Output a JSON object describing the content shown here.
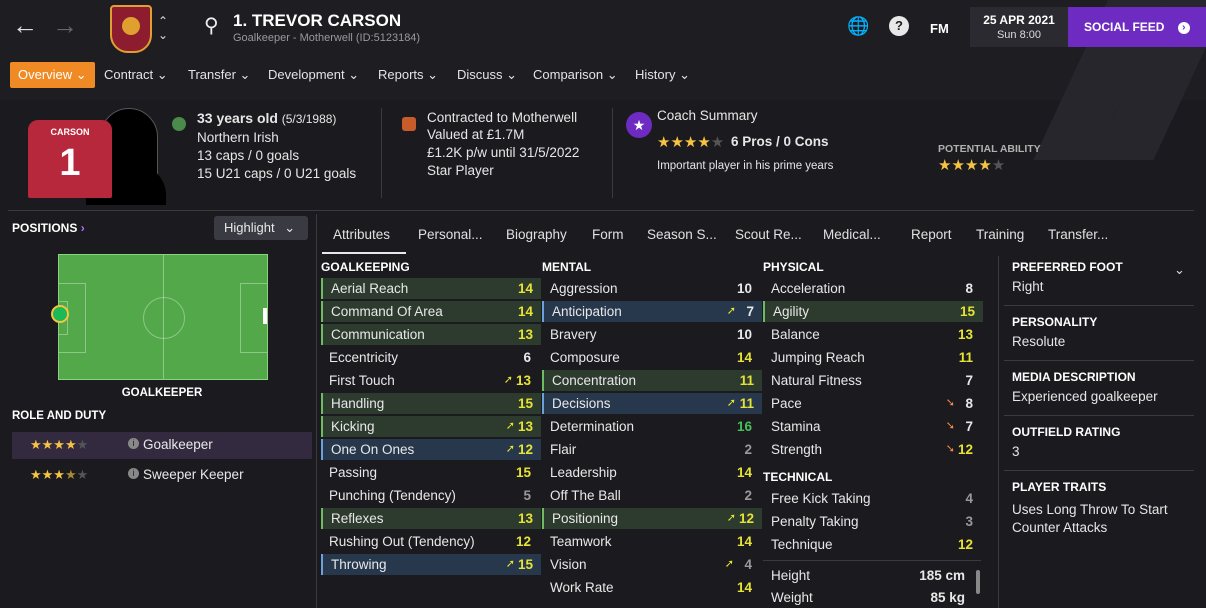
{
  "header": {
    "player_name": "1. TREVOR CARSON",
    "player_sub": "Goalkeeper - Motherwell (ID:5123184)",
    "fm_label": "FM",
    "help_label": "?",
    "date": "25 APR 2021",
    "time": "Sun 8:00",
    "social_feed": "SOCIAL FEED"
  },
  "menu": [
    "Overview",
    "Contract",
    "Transfer",
    "Development",
    "Reports",
    "Discuss",
    "Comparison",
    "History"
  ],
  "info": {
    "shirt_name": "CARSON",
    "shirt_number": "1",
    "age": "33 years old",
    "dob": "(5/3/1988)",
    "nationality": "Northern Irish",
    "caps": "13 caps / 0 goals",
    "u21_caps": "15 U21 caps / 0 U21 goals",
    "contract": "Contracted to Motherwell",
    "value": "Valued at £1.7M",
    "wage": "£1.2K p/w until 31/5/2022",
    "status": "Star Player",
    "coach_summary": "Coach Summary",
    "pros_cons": "6 Pros / 0 Cons",
    "coach_note": "Important player in his prime years",
    "potential_label": "POTENTIAL ABILITY",
    "current_ability_stars": 4,
    "potential_ability_stars": 4
  },
  "left_panel": {
    "positions_label": "POSITIONS",
    "highlight_label": "Highlight",
    "position_name": "GOALKEEPER",
    "role_duty_label": "ROLE AND DUTY",
    "roles": [
      {
        "name": "Goalkeeper",
        "stars": 4
      },
      {
        "name": "Sweeper Keeper",
        "stars": 3.5
      }
    ]
  },
  "tabs": [
    "Attributes",
    "Personal...",
    "Biography",
    "Form",
    "Season S...",
    "Scout Re...",
    "Medical...",
    "Report",
    "Training",
    "Transfer..."
  ],
  "attributes": {
    "goalkeeping_title": "GOALKEEPING",
    "goalkeeping": [
      {
        "name": "Aerial Reach",
        "value": "14"
      },
      {
        "name": "Command Of Area",
        "value": "14"
      },
      {
        "name": "Communication",
        "value": "13"
      },
      {
        "name": "Eccentricity",
        "value": "6"
      },
      {
        "name": "First Touch",
        "value": "13"
      },
      {
        "name": "Handling",
        "value": "15"
      },
      {
        "name": "Kicking",
        "value": "13"
      },
      {
        "name": "One On Ones",
        "value": "12"
      },
      {
        "name": "Passing",
        "value": "15"
      },
      {
        "name": "Punching (Tendency)",
        "value": "5"
      },
      {
        "name": "Reflexes",
        "value": "13"
      },
      {
        "name": "Rushing Out (Tendency)",
        "value": "12"
      },
      {
        "name": "Throwing",
        "value": "15"
      }
    ],
    "mental_title": "MENTAL",
    "mental": [
      {
        "name": "Aggression",
        "value": "10"
      },
      {
        "name": "Anticipation",
        "value": "7"
      },
      {
        "name": "Bravery",
        "value": "10"
      },
      {
        "name": "Composure",
        "value": "14"
      },
      {
        "name": "Concentration",
        "value": "11"
      },
      {
        "name": "Decisions",
        "value": "11"
      },
      {
        "name": "Determination",
        "value": "16"
      },
      {
        "name": "Flair",
        "value": "2"
      },
      {
        "name": "Leadership",
        "value": "14"
      },
      {
        "name": "Off The Ball",
        "value": "2"
      },
      {
        "name": "Positioning",
        "value": "12"
      },
      {
        "name": "Teamwork",
        "value": "14"
      },
      {
        "name": "Vision",
        "value": "4"
      },
      {
        "name": "Work Rate",
        "value": "14"
      }
    ],
    "physical_title": "PHYSICAL",
    "physical": [
      {
        "name": "Acceleration",
        "value": "8"
      },
      {
        "name": "Agility",
        "value": "15"
      },
      {
        "name": "Balance",
        "value": "13"
      },
      {
        "name": "Jumping Reach",
        "value": "11"
      },
      {
        "name": "Natural Fitness",
        "value": "7"
      },
      {
        "name": "Pace",
        "value": "8"
      },
      {
        "name": "Stamina",
        "value": "7"
      },
      {
        "name": "Strength",
        "value": "12"
      }
    ],
    "technical_title": "TECHNICAL",
    "technical": [
      {
        "name": "Free Kick Taking",
        "value": "4"
      },
      {
        "name": "Penalty Taking",
        "value": "3"
      },
      {
        "name": "Technique",
        "value": "12"
      }
    ],
    "height_label": "Height",
    "height": "185 cm",
    "weight_label": "Weight",
    "weight": "85 kg"
  },
  "right_panel": {
    "preferred_foot_label": "PREFERRED FOOT",
    "preferred_foot": "Right",
    "personality_label": "PERSONALITY",
    "personality": "Resolute",
    "media_label": "MEDIA DESCRIPTION",
    "media": "Experienced goalkeeper",
    "outfield_label": "OUTFIELD RATING",
    "outfield": "3",
    "traits_label": "PLAYER TRAITS",
    "traits_line1": "Uses Long Throw To Start",
    "traits_line2": "Counter Attacks"
  },
  "colors": {
    "accent_orange": "#f08a24",
    "social_purple": "#6e2bc2",
    "value_yellow": "#e7e335",
    "value_green": "#48c05a"
  }
}
